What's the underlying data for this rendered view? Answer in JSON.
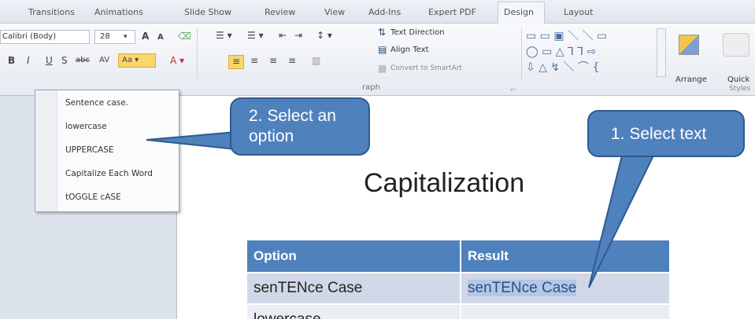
{
  "tabs": [
    {
      "label": "Transitions"
    },
    {
      "label": "Animations"
    },
    {
      "label": "Slide Show"
    },
    {
      "label": "Review"
    },
    {
      "label": "View"
    },
    {
      "label": "Add-Ins"
    },
    {
      "label": "Expert PDF"
    },
    {
      "label": "Design"
    },
    {
      "label": "Layout"
    }
  ],
  "ribbon": {
    "font_name": "Calibri (Body)",
    "font_size": "28",
    "text_direction": "Text Direction",
    "align_text": "Align Text",
    "convert_smartart": "Convert to SmartArt",
    "arrange": "Arrange",
    "quick": "Quick",
    "styles": "Styles",
    "paragraph_group": "raph"
  },
  "menu": {
    "items": [
      "Sentence case.",
      "lowercase",
      "UPPERCASE",
      "Capitalize Each Word",
      "tOGGLE cASE"
    ]
  },
  "callouts": {
    "select_option": "2. Select an option",
    "select_text": "1. Select text"
  },
  "slide": {
    "title": "Capitalization",
    "table": {
      "headers": [
        "Option",
        "Result"
      ],
      "rows": [
        [
          "senTENce Case",
          "senTENce Case"
        ],
        [
          "lowercase",
          ""
        ]
      ]
    }
  }
}
